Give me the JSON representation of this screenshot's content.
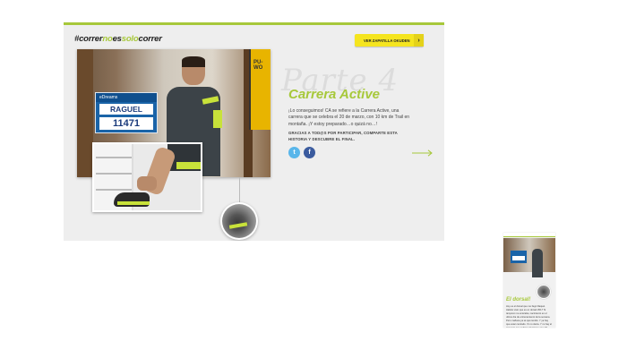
{
  "desktop": {
    "hashtag": {
      "part1": "#correr",
      "part2": "no",
      "part3": "es",
      "part4": "solo",
      "part5": "correr"
    },
    "cta": {
      "label": "VER ZAPATILLA OKUDEN",
      "arrow": "›"
    },
    "photo": {
      "bib_brand": "eDreams",
      "bib_name": "RAGUEL",
      "bib_number": "11471",
      "poster_text": "PU-WO"
    },
    "script_background": "Parte 4",
    "title": "Carrera Active",
    "body": "¡Lo conseguimos! CA se refiere a la Carrera Active, una carrera que se celebra el 20 de marzo, con 10 km de Trail en montaña. ¡Y estoy preparado…o quizá no…!",
    "bold_text": "GRACIAS A TOD@S POR PARTICIPAR, COMPARTE ESTA HISTORIA Y DESCUBRE EL FINAL.",
    "social": {
      "twitter_glyph": "t",
      "facebook_glyph": "f"
    }
  },
  "mobile": {
    "title": "El dorsal!",
    "body": "Hoy es el dorsal que me llegó Raquel. Habéis visto que es un dorsal VRL? Si tampoco me enteraba, nacimiento en el ultimo día de entrenamiento de la semana. Pero mañana ya sé qué tendré. Y ya hay que estar centrado. Yo no decía. Y no hay el recuento que pudiera afectarme con 17!"
  },
  "colors": {
    "accent": "#a7c83a",
    "cta": "#f5e51f",
    "twitter": "#59b6ea",
    "facebook": "#3b5b9e"
  },
  "icons": [
    "chevron-right-icon",
    "twitter-icon",
    "facebook-icon",
    "arrow-right-icon"
  ]
}
